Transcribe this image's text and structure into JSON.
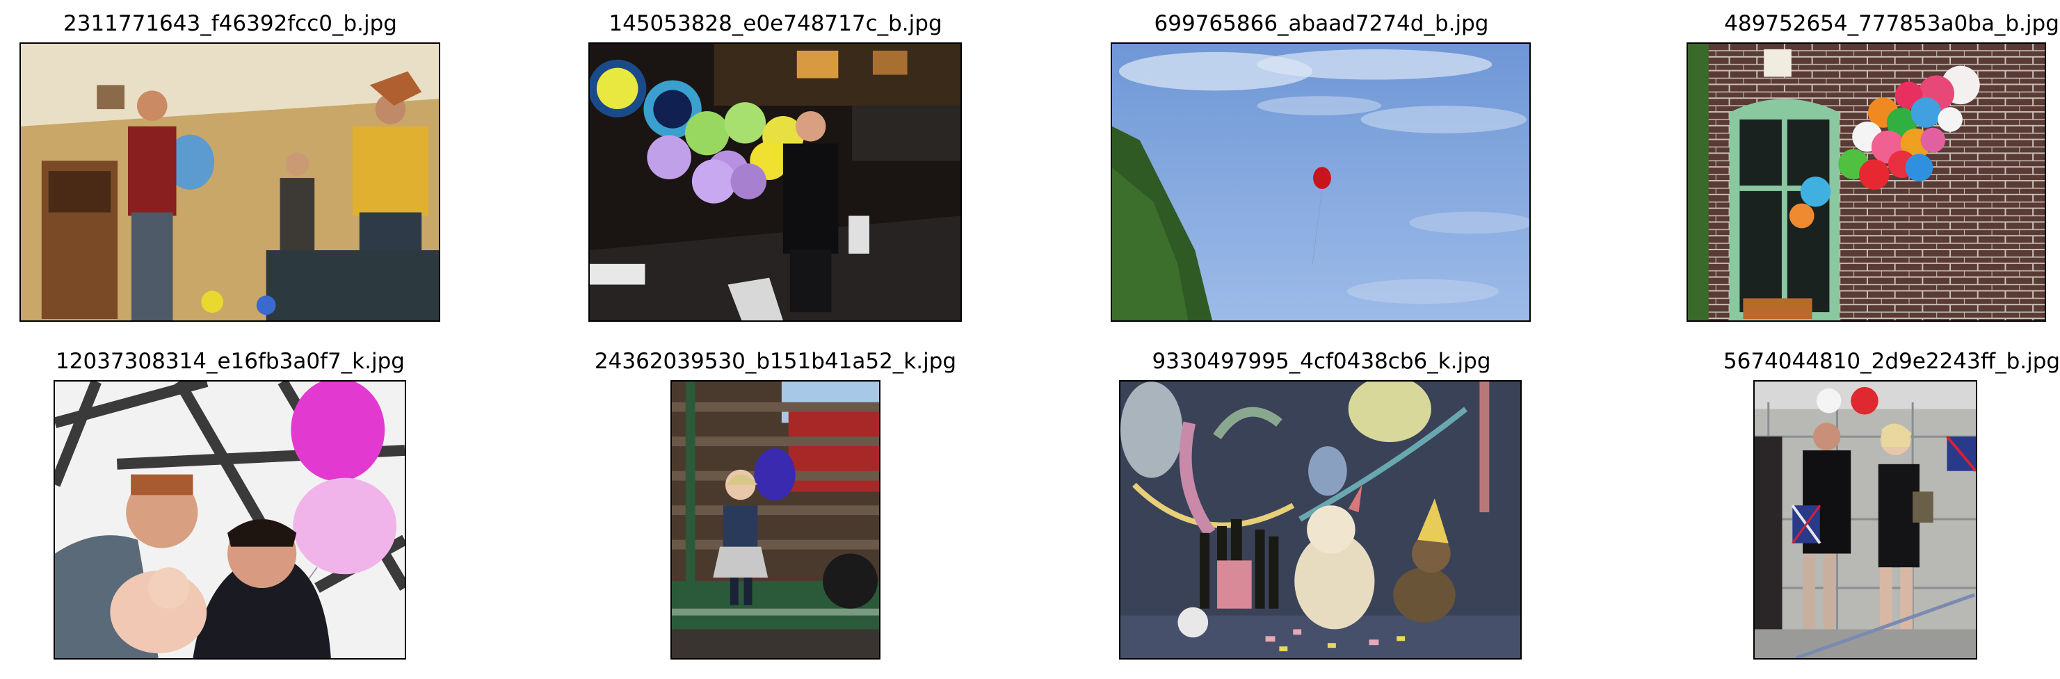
{
  "images": [
    {
      "filename": "2311771643_f46392fcc0_b.jpg",
      "scene": "room"
    },
    {
      "filename": "145053828_e0e748717c_b.jpg",
      "scene": "night-street"
    },
    {
      "filename": "699765866_abaad7274d_b.jpg",
      "scene": "sky"
    },
    {
      "filename": "489752654_777853a0ba_b.jpg",
      "scene": "brick-wall"
    },
    {
      "filename": "12037308314_e16fb3a0f7_k.jpg",
      "scene": "window-family"
    },
    {
      "filename": "24362039530_b151b41a52_k.jpg",
      "scene": "railway-cart"
    },
    {
      "filename": "9330497995_4cf0438cb6_k.jpg",
      "scene": "party-dogs"
    },
    {
      "filename": "5674044810_2d9e2243ff_b.jpg",
      "scene": "street-flags"
    }
  ]
}
